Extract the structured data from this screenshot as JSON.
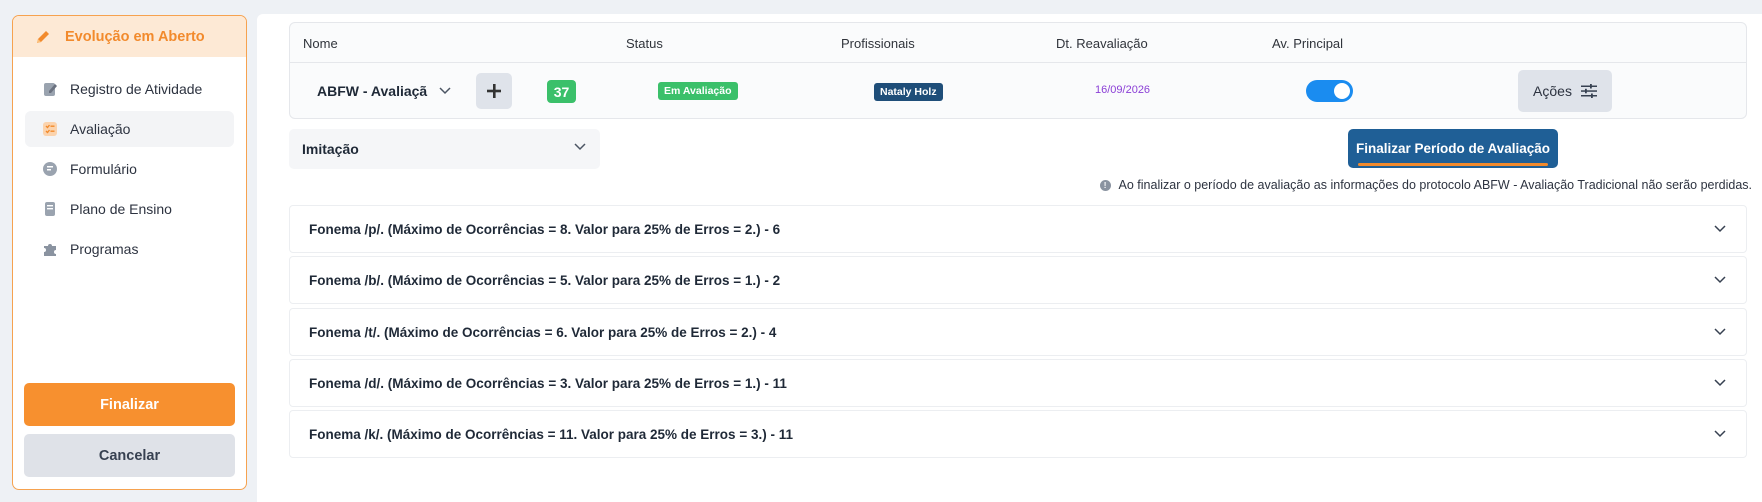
{
  "sidebar": {
    "header": "Evolução em Aberto",
    "items": [
      {
        "label": "Registro de Atividade",
        "icon": "edit-doc-icon"
      },
      {
        "label": "Avaliação",
        "icon": "checklist-icon"
      },
      {
        "label": "Formulário",
        "icon": "form-icon"
      },
      {
        "label": "Plano de Ensino",
        "icon": "book-icon"
      },
      {
        "label": "Programas",
        "icon": "puzzle-icon"
      }
    ],
    "finalizar": "Finalizar",
    "cancelar": "Cancelar"
  },
  "table": {
    "headers": {
      "nome": "Nome",
      "status": "Status",
      "profissionais": "Profissionais",
      "reavaliacao": "Dt. Reavaliação",
      "principal": "Av. Principal"
    },
    "row": {
      "nome": "ABFW - Avaliaçã",
      "count": "37",
      "status": "Em Avaliação",
      "profissional": "Nataly Holz",
      "data": "16/09/2026",
      "principal_on": true,
      "acoes": "Ações"
    }
  },
  "imitacao": "Imitação",
  "finalizar_periodo": "Finalizar Período de Avaliação",
  "info": "Ao finalizar o período de avaliação as informações do protocolo ABFW - Avaliação Tradicional não serão perdidas.",
  "fonemas": [
    "Fonema /p/. (Máximo de Ocorrências = 8. Valor para 25% de Erros = 2.) - 6",
    "Fonema /b/. (Máximo de Ocorrências = 5. Valor para 25% de Erros = 1.) - 2",
    "Fonema /t/. (Máximo de Ocorrências = 6. Valor para 25% de Erros = 2.) - 4",
    "Fonema /d/. (Máximo de Ocorrências = 3. Valor para 25% de Erros = 1.) - 11",
    "Fonema /k/. (Máximo de Ocorrências = 11. Valor para 25% de Erros = 3.) - 11"
  ],
  "colors": {
    "accent_orange": "#f7902f",
    "primary_blue": "#1f5f96",
    "success_green": "#3bc06a",
    "toggle_blue": "#1a8cf0",
    "date_purple": "#8b3fd6"
  }
}
